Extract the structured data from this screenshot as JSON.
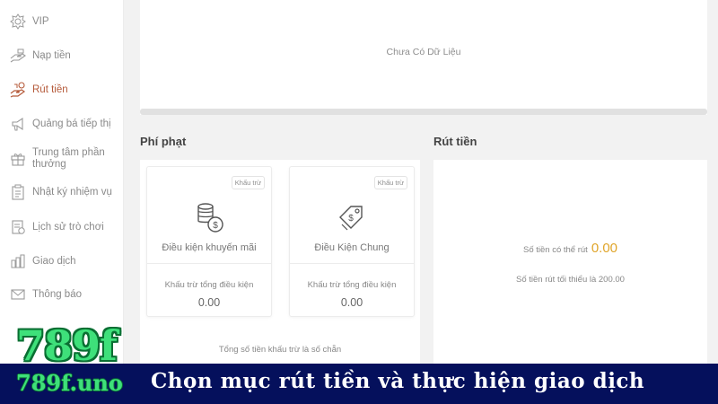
{
  "sidebar": {
    "items": [
      {
        "label": "VIP",
        "icon": "vip-gear-icon",
        "active": false
      },
      {
        "label": "Nạp tiền",
        "icon": "deposit-hand-icon",
        "active": false
      },
      {
        "label": "Rút tiền",
        "icon": "withdraw-hand-icon",
        "active": true
      },
      {
        "label": "Quảng bá tiếp thị",
        "icon": "megaphone-icon",
        "active": false
      },
      {
        "label": "Trung tâm phần thưởng",
        "icon": "gift-icon",
        "active": false
      },
      {
        "label": "Nhật ký nhiệm vụ",
        "icon": "clipboard-icon",
        "active": false
      },
      {
        "label": "Lịch sử trò chơi",
        "icon": "history-icon",
        "active": false
      },
      {
        "label": "Giao dịch",
        "icon": "transaction-icon",
        "active": false
      },
      {
        "label": "Thông báo",
        "icon": "mail-icon",
        "active": false
      }
    ]
  },
  "top_panel": {
    "empty_text": "Chưa Có Dữ Liệu"
  },
  "penalty": {
    "title": "Phí phạt",
    "cards": [
      {
        "badge": "Khấu trừ",
        "name": "Điều kiện khuyến mãi",
        "sub_label": "Khấu trừ tổng điều kiện",
        "amount": "0.00",
        "icon": "coins-icon"
      },
      {
        "badge": "Khấu trừ",
        "name": "Điều Kiện Chung",
        "sub_label": "Khấu trừ tổng điều kiện",
        "amount": "0.00",
        "icon": "price-tag-icon"
      }
    ],
    "total_text": "Tổng số tiền khấu trừ là số chẵn"
  },
  "withdraw": {
    "title": "Rút tiền",
    "available_label": "Số tiền có thể rút",
    "available_value": "0.00",
    "minimum_text": "Số tiền rút tối thiểu là 200.00"
  },
  "banner": {
    "logo_big": "789f",
    "logo_small": "789f.uno",
    "caption": "Chọn mục rút tiền và thực hiện giao dịch"
  },
  "colors": {
    "accent_active": "#b55a3a",
    "amount_gold": "#e0a52a",
    "banner_bg": "#05105c",
    "logo_green": "#3ee07a"
  }
}
